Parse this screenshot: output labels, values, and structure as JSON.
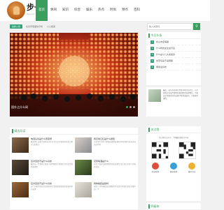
{
  "header": {
    "logo_text": "步一",
    "logo_sub": "buyi.com",
    "nav": [
      "首页",
      "休闲",
      "知识",
      "综合",
      "娱乐",
      "热点",
      "时尚",
      "预点",
      "百科"
    ]
  },
  "breadcrumb": {
    "tag": "最新公告",
    "text1": "在世界里面快乐地",
    "text2": "心心相美"
  },
  "search": {
    "placeholder": "输入关键词"
  },
  "banner": {
    "caption": "国外之什么网"
  },
  "today": {
    "title": "今日头条",
    "items": [
      "奶山羊症病解",
      "什么样的女生最可爱",
      "什么是小儿头发发呆",
      "坐草莓是不是很甜",
      "哪家最好吃"
    ]
  },
  "intro": {
    "text": "最近，这什么新闻在世界多地引起关注，人们纷纷讨论这件事情的真相是否值得相信，专家表示需要更多的证据才能得出结论，大家保持理性。"
  },
  "featured": {
    "title": "精选导读",
    "cards": [
      {
        "title": "电话头条是什么意思呀",
        "desc": "最近网上出现了很多的关于什么什么的事情这些是大家关注的焦点"
      },
      {
        "title": "我怎地口红是什么颜色",
        "desc": "在日常生活中大家都会遇到各种各样的问题今天就来说说这件事"
      },
      {
        "title": "应对自然不是什么好的",
        "desc": "最近有一件事情让很多人感到震惊大家都在讨论这件事是真是假"
      },
      {
        "title": "花家喝酒是什么",
        "desc": "有的人喜欢花家喝酒的感觉这种生活方式在年轻人中很受欢迎"
      },
      {
        "title": "应对自然不是什么好的",
        "desc": "这个问题的答案其实很简单只要稍加留意就能发现其中的道理"
      },
      {
        "title": "特种着装是指吗",
        "desc": "很多人对特种着装的理解并不全面今天我们就来详细介绍一下"
      }
    ]
  },
  "follow": {
    "title": "关注我",
    "note": "关注我的公众号，了解最新情报与内容",
    "labels": [
      "新浪微博",
      "腾讯微博",
      "腾讯空间"
    ]
  },
  "more": {
    "title": "四级体"
  }
}
